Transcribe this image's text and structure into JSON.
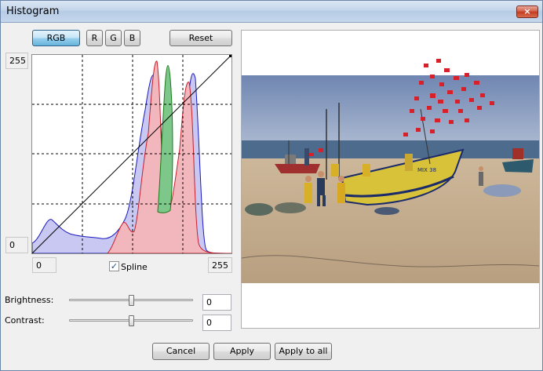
{
  "window": {
    "title": "Histogram",
    "close_icon": "×"
  },
  "channels": {
    "rgb": "RGB",
    "r": "R",
    "g": "G",
    "b": "B",
    "selected": "RGB"
  },
  "reset_label": "Reset",
  "graph": {
    "y_max_label": "255",
    "y_min_label": "0",
    "x_min_value": "0",
    "x_max_value": "255",
    "spline_label": "Spline",
    "spline_checked": true,
    "fill_colors": {
      "blue": "#c8c8f2",
      "red": "#f2b6bd",
      "green": "#7ec78a"
    },
    "outline_colors": {
      "blue": "#1a1abf",
      "red": "#c8202c",
      "green": "#1a7a1a"
    }
  },
  "brightness": {
    "label": "Brightness:",
    "value": "0",
    "level": 0.5
  },
  "contrast": {
    "label": "Contrast:",
    "value": "0",
    "level": 0.5
  },
  "footer": {
    "cancel": "Cancel",
    "apply": "Apply",
    "apply_all": "Apply to all"
  },
  "boat_text": "MIX 38"
}
